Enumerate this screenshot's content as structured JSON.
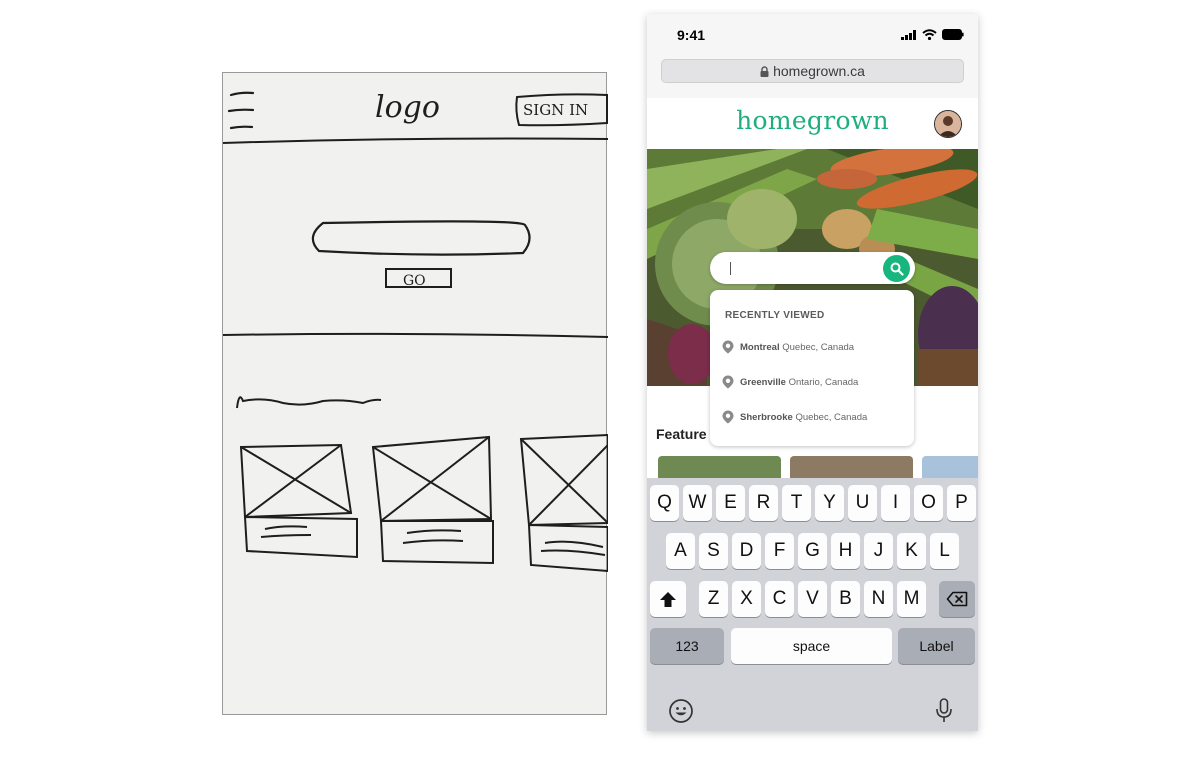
{
  "sketch": {
    "logo_text": "logo",
    "signin_text": "SIGN IN",
    "go_text": "GO"
  },
  "status_bar": {
    "time": "9:41"
  },
  "browser": {
    "url": "homegrown.ca"
  },
  "app": {
    "logo": "homegrown"
  },
  "search": {
    "placeholder": "",
    "value": ""
  },
  "recently_viewed": {
    "title": "RECENTLY VIEWED",
    "items": [
      {
        "city": "Montreal",
        "region": "Quebec, Canada"
      },
      {
        "city": "Greenville",
        "region": "Ontario, Canada"
      },
      {
        "city": "Sherbrooke",
        "region": "Quebec, Canada"
      }
    ]
  },
  "featured": {
    "title": "Feature"
  },
  "keyboard": {
    "row1": [
      "Q",
      "W",
      "E",
      "R",
      "T",
      "Y",
      "U",
      "I",
      "O",
      "P"
    ],
    "row2": [
      "A",
      "S",
      "D",
      "F",
      "G",
      "H",
      "J",
      "K",
      "L"
    ],
    "row3": [
      "Z",
      "X",
      "C",
      "V",
      "B",
      "N",
      "M"
    ],
    "numbers_label": "123",
    "space_label": "space",
    "return_label": "Label",
    "shift_icon": "shift-icon",
    "delete_icon": "delete-icon",
    "emoji_icon": "emoji-icon",
    "mic_icon": "microphone-icon"
  },
  "colors": {
    "brand": "#1fae7f",
    "search_button": "#17b67e"
  }
}
